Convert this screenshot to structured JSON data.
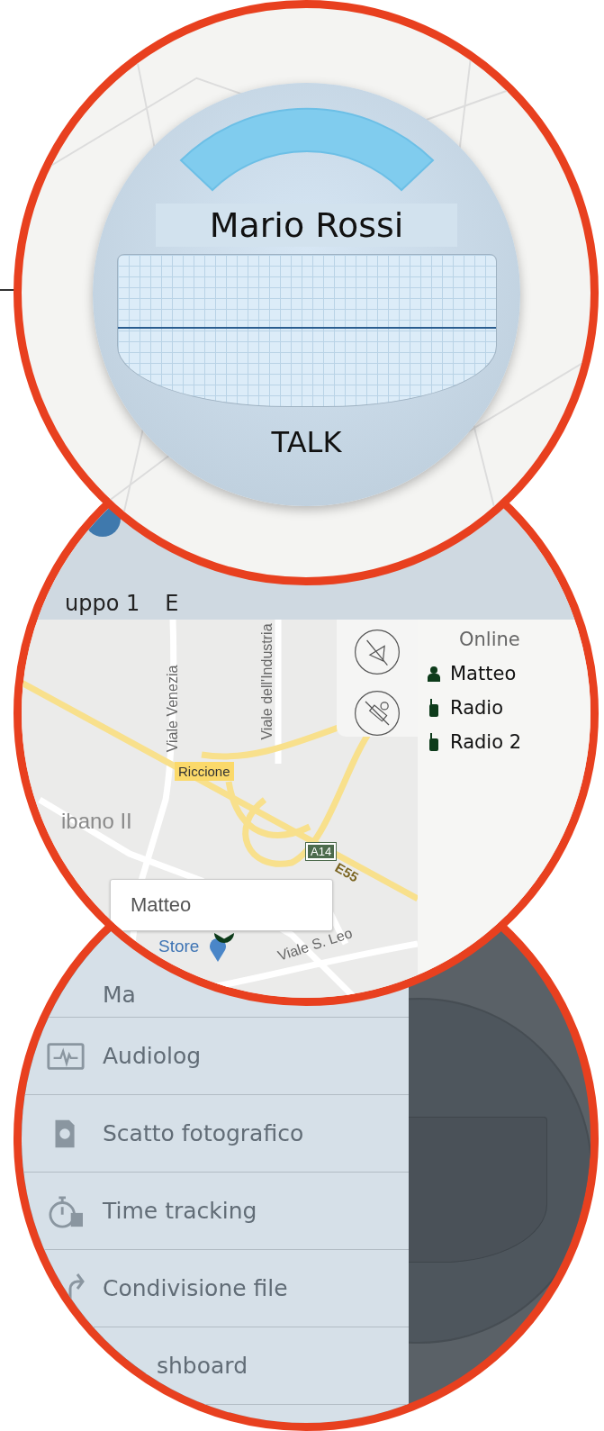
{
  "talk_screen": {
    "contact_name": "Mario Rossi",
    "talk_button": "TALK"
  },
  "map_screen": {
    "header_tabs": [
      {
        "label": "uppo 1"
      },
      {
        "label": "E"
      }
    ],
    "map": {
      "street_1": "Viale Venezia",
      "street_2": "Viale dell'Industria",
      "town_badge": "Riccione",
      "place": "ibano II",
      "road_shield": "A14",
      "route": "E55",
      "marker_popup": "Matteo",
      "place_2": "Store",
      "street_3": "Viale S. Leo"
    },
    "online_panel": {
      "title": "Online",
      "users": [
        {
          "name": "Matteo",
          "kind": "person"
        },
        {
          "name": "Radio",
          "kind": "radio"
        },
        {
          "name": "Radio 2",
          "kind": "radio"
        }
      ]
    }
  },
  "menu_screen": {
    "items": [
      {
        "label": "Ma",
        "kind": "map"
      },
      {
        "label": "Audiolog",
        "kind": "audio"
      },
      {
        "label": "Scatto fotografico",
        "kind": "photo"
      },
      {
        "label": "Time tracking",
        "kind": "timer"
      },
      {
        "label": "Condivisione file",
        "kind": "share"
      },
      {
        "label": "shboard",
        "kind": "dashboard"
      }
    ]
  }
}
